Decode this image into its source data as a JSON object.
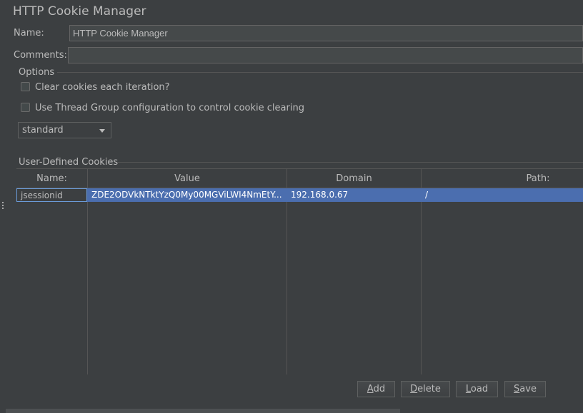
{
  "panel": {
    "title": "HTTP Cookie Manager",
    "name_label": "Name:",
    "name_value": "HTTP Cookie Manager",
    "comments_label": "Comments:",
    "comments_value": ""
  },
  "options": {
    "legend": "Options",
    "clear_each_iteration": {
      "label": "Clear cookies each iteration?",
      "checked": false
    },
    "use_thread_group": {
      "label": "Use Thread Group configuration to control cookie clearing",
      "checked": false
    },
    "policy_select": {
      "value": "standard"
    }
  },
  "cookies": {
    "legend": "User-Defined Cookies",
    "columns": [
      "Name:",
      "Value",
      "Domain",
      "Path:"
    ],
    "rows": [
      {
        "name": "jsessionid",
        "value": "ZDE2ODVkNTktYzQ0My00MGViLWI4NmEtY...",
        "domain": "192.168.0.67",
        "path": "/"
      }
    ]
  },
  "buttons": {
    "add": {
      "pre": "",
      "mnemonic": "A",
      "post": "dd"
    },
    "delete": {
      "pre": "",
      "mnemonic": "D",
      "post": "elete"
    },
    "load": {
      "pre": "",
      "mnemonic": "L",
      "post": "oad"
    },
    "save": {
      "pre": "",
      "mnemonic": "S",
      "post": "ave"
    }
  },
  "colors": {
    "background": "#3c3f41",
    "selection": "#4b6eaf",
    "text": "#bbbbbb"
  }
}
